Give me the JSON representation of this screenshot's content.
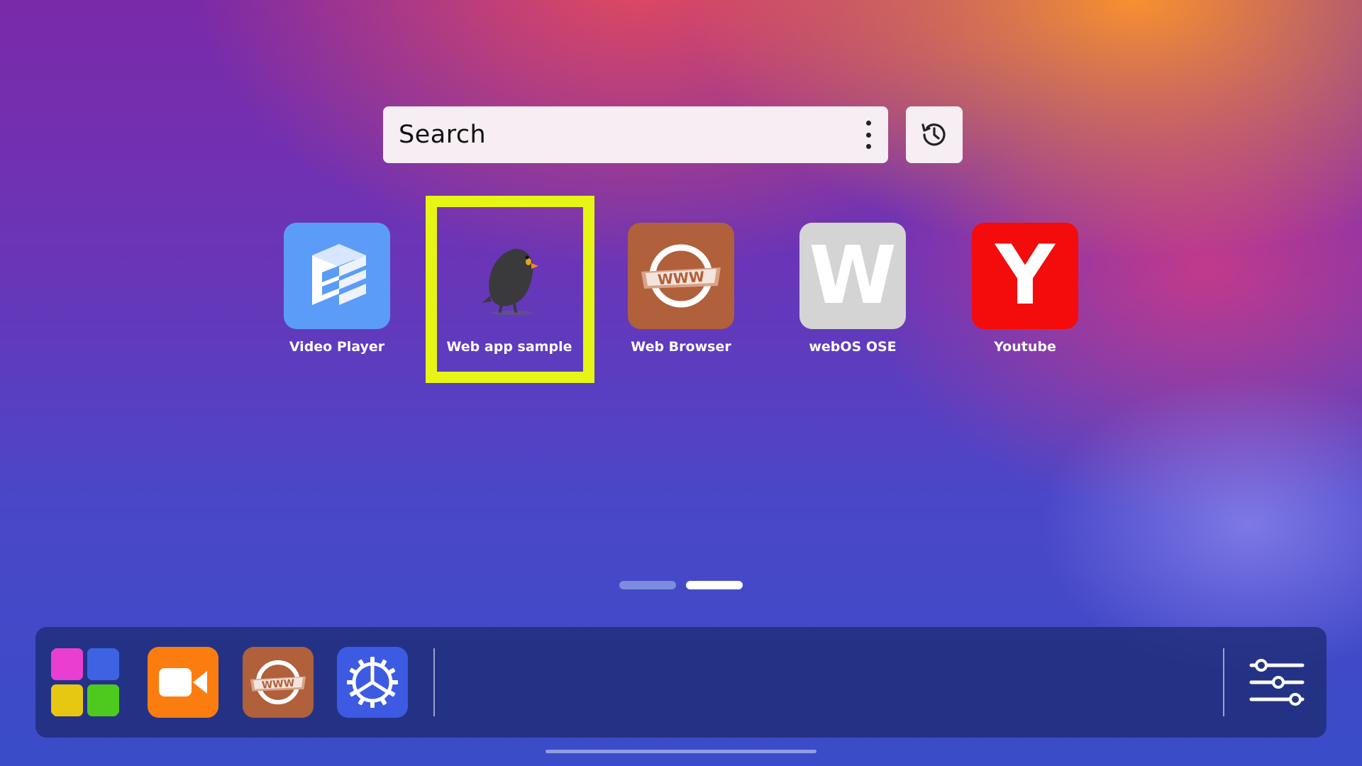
{
  "search": {
    "placeholder": "Search"
  },
  "apps": [
    {
      "label": "Video Player",
      "icon": "video-player-icon",
      "color": "#5b9cf8"
    },
    {
      "label": "Web app sample",
      "icon": "bird-mascot-icon",
      "color": "#7a36ad"
    },
    {
      "label": "Web Browser",
      "icon": "www-globe-icon",
      "color": "#b0603a"
    },
    {
      "label": "webOS OSE",
      "icon": "w-letter-icon",
      "color": "#d4d4d4",
      "glyph": "W"
    },
    {
      "label": "Youtube",
      "icon": "y-letter-icon",
      "color": "#f40b0b",
      "glyph": "Y"
    }
  ],
  "focus": {
    "color": "#e6f516",
    "selected_app": "Web app sample"
  },
  "pagination": {
    "pages": 2,
    "current": 2
  },
  "dock": {
    "items": [
      {
        "name": "all-apps-grid-icon"
      },
      {
        "name": "video-camera-icon",
        "color": "#fb7d10"
      },
      {
        "name": "www-globe-icon",
        "color": "#b0603a"
      },
      {
        "name": "settings-gear-icon",
        "color": "#3d5ae3"
      }
    ],
    "right_item": "sliders-icon"
  },
  "colors": {
    "grid_tiles": [
      "#e93fd1",
      "#3e63e2",
      "#e6c812",
      "#4ec91e"
    ]
  }
}
